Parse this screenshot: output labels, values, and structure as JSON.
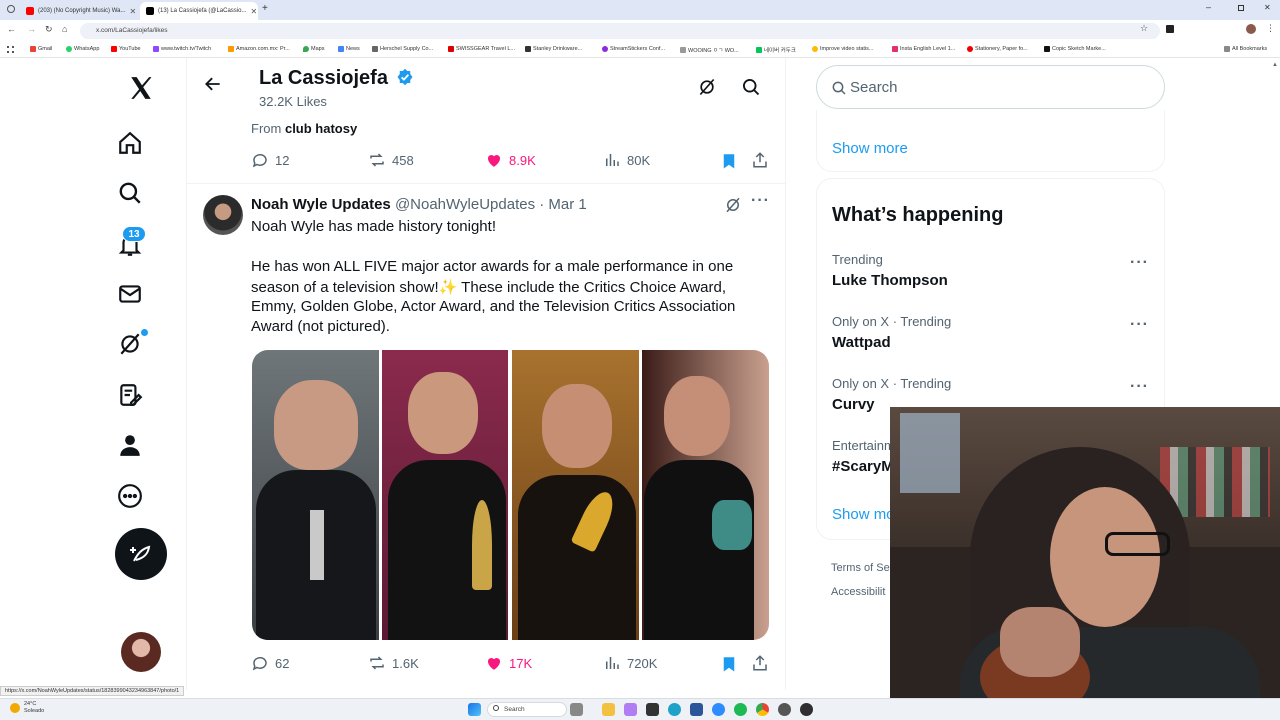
{
  "browser": {
    "tabs": [
      {
        "title": "(203) (No Copyright Music) Wa..."
      },
      {
        "title": "(13) La Cassiojefa (@LaCassio..."
      }
    ],
    "url": "x.com/LaCassiojefa/likes",
    "bookmarks": [
      "Gmail",
      "WhatsApp",
      "YouTube",
      "www.twitch.tv/Twitch",
      "Amazon.com.mx: Pr...",
      "Maps",
      "News",
      "Herschel Supply Co...",
      "SWISSGEAR Travel L...",
      "Stanley Drinkware...",
      "StreamStickers Conf...",
      "WOOING ㅇㄱ WO...",
      "네이버 커두크",
      "Improve video statis...",
      "Insta English Level 1...",
      "Stationery, Paper fo...",
      "Copic Sketch Marke..."
    ],
    "all_bookmarks": "All Bookmarks",
    "status_url": "https://x.com/NoahWyleUpdates/status/1828399043234963847/photo/1"
  },
  "nav": {
    "notifications_badge": "13"
  },
  "profile_header": {
    "name": "La Cassiojefa",
    "subtitle": "32.2K Likes"
  },
  "prev_tweet": {
    "from_label": "From",
    "from_source": "club hatosy",
    "replies": "12",
    "reposts": "458",
    "likes": "8.9K",
    "views": "80K"
  },
  "tweet": {
    "author": "Noah Wyle Updates",
    "handle": "@NoahWyleUpdates",
    "date": "· Mar 1",
    "line1": "Noah Wyle has made history tonight!",
    "body": [
      "He has won ALL FIVE major actor awards for a male performance in one",
      "season of a television show!✨ These include the Critics Choice Award,",
      "Emmy, Golden Globe, Actor Award, and the Television Critics Association",
      "Award (not pictured)."
    ],
    "replies": "62",
    "reposts": "1.6K",
    "likes": "17K",
    "views": "720K"
  },
  "sidebar": {
    "search_placeholder": "Search",
    "show_more_top": "Show more",
    "whats_happening": "What’s happening",
    "trends": [
      {
        "context": "Trending",
        "name": "Luke Thompson"
      },
      {
        "context": "Only on X · Trending",
        "name": "Wattpad"
      },
      {
        "context": "Only on X · Trending",
        "name": "Curvy"
      },
      {
        "context": "Entertainm",
        "name": "#ScaryM"
      }
    ],
    "show_more_bottom": "Show mo",
    "footer": [
      "Terms of Se",
      "Accessibilit"
    ]
  },
  "taskbar": {
    "weather_temp": "24°C",
    "weather_desc": "Soleado",
    "search": "Search"
  },
  "colors": {
    "accent": "#1d9bf0",
    "like_pink": "#f91880",
    "text_secondary": "#536471",
    "verified": "#1d9bf0"
  }
}
